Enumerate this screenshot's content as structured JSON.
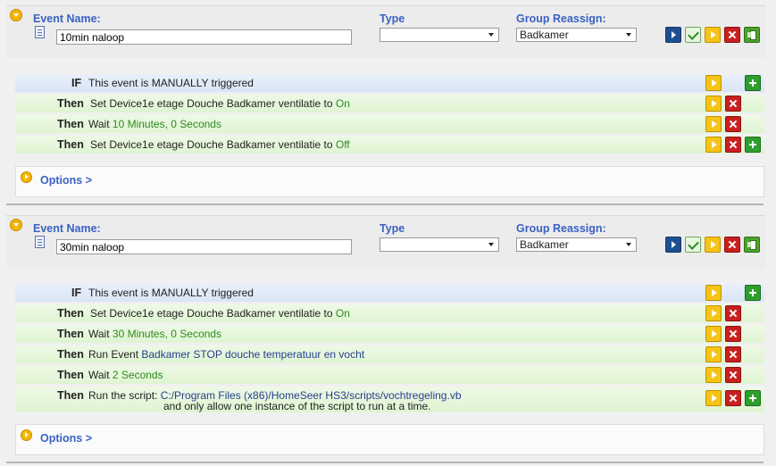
{
  "labels": {
    "event_name": "Event Name:",
    "type": "Type",
    "group_reassign": "Group Reassign:",
    "if": "IF",
    "then": "Then",
    "options": "Options >"
  },
  "events": [
    {
      "name": "10min naloop",
      "type": "",
      "group": "Badkamer",
      "trigger": "This event is MANUALLY triggered",
      "actions": [
        {
          "prefix": "Set Device",
          "device": "1e etage Douche Badkamer ventilatie",
          "mid": " to ",
          "value": "On"
        },
        {
          "prefix": "Wait ",
          "value": "10 Minutes, 0 Seconds"
        },
        {
          "prefix": "Set Device",
          "device": "1e etage Douche Badkamer ventilatie",
          "mid": " to ",
          "value": "Off"
        }
      ]
    },
    {
      "name": "30min naloop",
      "type": "",
      "group": "Badkamer",
      "trigger": "This event is MANUALLY triggered",
      "actions": [
        {
          "prefix": "Set Device",
          "device": "1e etage Douche Badkamer ventilatie",
          "mid": " to ",
          "value": "On"
        },
        {
          "prefix": "Wait ",
          "value": "30 Minutes, 0 Seconds"
        },
        {
          "prefix": "Run Event ",
          "value": "Badkamer STOP douche temperatuur en vocht"
        },
        {
          "prefix": "Wait ",
          "value": "2 Seconds"
        },
        {
          "prefix": "Run the script: ",
          "value": "C:/Program Files (x86)/HomeSeer HS3/scripts/vochtregeling.vb",
          "line2": "and only allow one instance of the script to run at a time."
        }
      ]
    }
  ]
}
